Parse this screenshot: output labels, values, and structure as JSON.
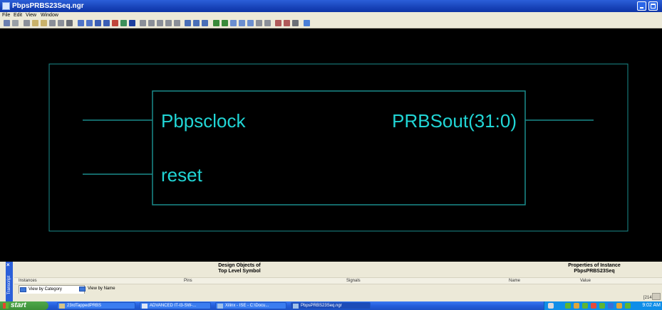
{
  "window": {
    "title": "PbpsPRBS23Seq.ngr"
  },
  "menu": [
    "File",
    "Edit",
    "View",
    "Window"
  ],
  "schematic": {
    "input_pins": [
      "Pbpsclock",
      "reset"
    ],
    "output_pins": [
      "PRBSout(31:0)"
    ],
    "line_color": "#1a8c8c",
    "text_color": "#21d5d5"
  },
  "panel": {
    "transcript_label": "Transcript",
    "design_objects_title_1": "Design Objects of",
    "design_objects_title_2": "Top Level Symbol",
    "properties_title_1": "Properties of Instance",
    "properties_title_2": "PbpsPRBS23Seq",
    "col_instances": "Instances",
    "col_pins": "Pins",
    "col_signals": "Signals",
    "col_name": "Name",
    "col_value": "Value",
    "view_by_category": "View by Category",
    "view_by_name": "View by Name",
    "coords": "[214"
  },
  "taskbar": {
    "start": "start",
    "tasks": [
      "23rdTappedPRBS",
      "ADVANCED IT-I3-SW-...",
      "Xilinx - ISE - C:\\Docu...",
      "PbpsPRBS23Seq.ngr"
    ],
    "clock": "9:02 AM"
  }
}
